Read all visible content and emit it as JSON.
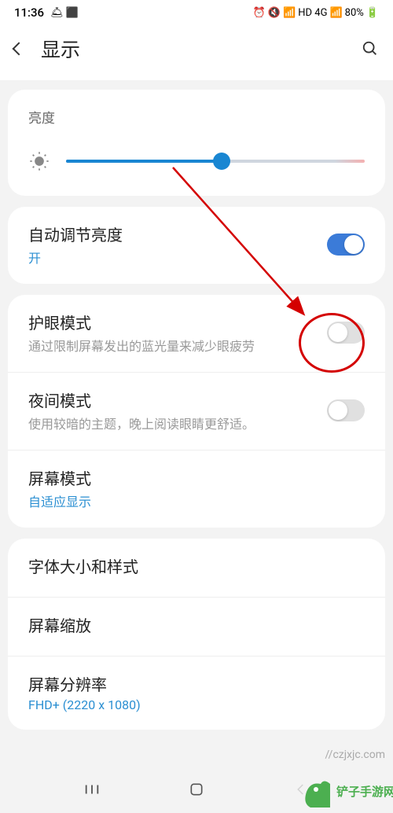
{
  "status_bar": {
    "time": "11:36",
    "battery": "80%",
    "indicators": "HD 4G"
  },
  "header": {
    "title": "显示"
  },
  "brightness": {
    "heading": "亮度",
    "value_percent": 52
  },
  "auto_brightness": {
    "title": "自动调节亮度",
    "value": "开",
    "enabled": true
  },
  "eye_care": {
    "title": "护眼模式",
    "sub": "通过限制屏幕发出的蓝光量来减少眼疲劳",
    "enabled": false
  },
  "night_mode": {
    "title": "夜间模式",
    "sub": "使用较暗的主题，晚上阅读眼睛更舒适。",
    "enabled": false
  },
  "screen_mode": {
    "title": "屏幕模式",
    "value": "自适应显示"
  },
  "font_size": {
    "title": "字体大小和样式"
  },
  "screen_zoom": {
    "title": "屏幕缩放"
  },
  "screen_resolution": {
    "title": "屏幕分辨率",
    "value": "FHD+ (2220 x 1080)"
  },
  "watermark": "//czjxjc.com",
  "logo_text": "铲子手游网"
}
